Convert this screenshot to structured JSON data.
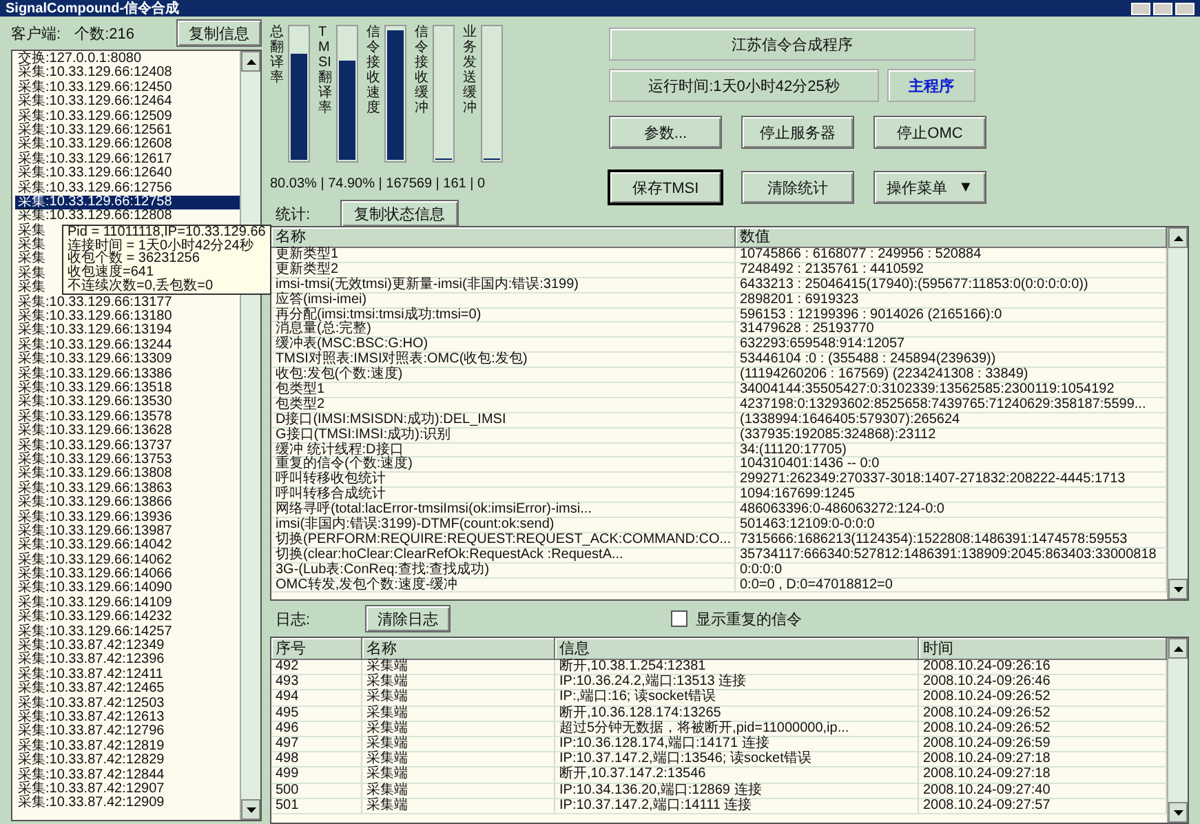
{
  "window": {
    "title": "SignalCompound-信令合成"
  },
  "clients": {
    "label": "客户端:",
    "count": "个数:216",
    "copy_button": "复制信息",
    "items": [
      {
        "text": "交换:127.0.0.1:8080",
        "selected": false
      },
      {
        "text": "采集:10.33.129.66:12408",
        "selected": false
      },
      {
        "text": "采集:10.33.129.66:12450",
        "selected": false
      },
      {
        "text": "采集:10.33.129.66:12464",
        "selected": false
      },
      {
        "text": "采集:10.33.129.66:12509",
        "selected": false
      },
      {
        "text": "采集:10.33.129.66:12561",
        "selected": false
      },
      {
        "text": "采集:10.33.129.66:12608",
        "selected": false
      },
      {
        "text": "采集:10.33.129.66:12617",
        "selected": false
      },
      {
        "text": "采集:10.33.129.66:12640",
        "selected": false
      },
      {
        "text": "采集:10.33.129.66:12756",
        "selected": false
      },
      {
        "text": "采集:10.33.129.66:12758",
        "selected": true
      },
      {
        "text": "采集:10.33.129.66:12808",
        "selected": false
      },
      {
        "text": "采集",
        "selected": false
      },
      {
        "text": "采集",
        "selected": false
      },
      {
        "text": "采集",
        "selected": false
      },
      {
        "text": "采集",
        "selected": false
      },
      {
        "text": "采集",
        "selected": false
      },
      {
        "text": "采集:10.33.129.66:13177",
        "selected": false
      },
      {
        "text": "采集:10.33.129.66:13180",
        "selected": false
      },
      {
        "text": "采集:10.33.129.66:13194",
        "selected": false
      },
      {
        "text": "采集:10.33.129.66:13244",
        "selected": false
      },
      {
        "text": "采集:10.33.129.66:13309",
        "selected": false
      },
      {
        "text": "采集:10.33.129.66:13386",
        "selected": false
      },
      {
        "text": "采集:10.33.129.66:13518",
        "selected": false
      },
      {
        "text": "采集:10.33.129.66:13530",
        "selected": false
      },
      {
        "text": "采集:10.33.129.66:13578",
        "selected": false
      },
      {
        "text": "采集:10.33.129.66:13628",
        "selected": false
      },
      {
        "text": "采集:10.33.129.66:13737",
        "selected": false
      },
      {
        "text": "采集:10.33.129.66:13753",
        "selected": false
      },
      {
        "text": "采集:10.33.129.66:13808",
        "selected": false
      },
      {
        "text": "采集:10.33.129.66:13863",
        "selected": false
      },
      {
        "text": "采集:10.33.129.66:13866",
        "selected": false
      },
      {
        "text": "采集:10.33.129.66:13936",
        "selected": false
      },
      {
        "text": "采集:10.33.129.66:13987",
        "selected": false
      },
      {
        "text": "采集:10.33.129.66:14042",
        "selected": false
      },
      {
        "text": "采集:10.33.129.66:14062",
        "selected": false
      },
      {
        "text": "采集:10.33.129.66:14066",
        "selected": false
      },
      {
        "text": "采集:10.33.129.66:14090",
        "selected": false
      },
      {
        "text": "采集:10.33.129.66:14109",
        "selected": false
      },
      {
        "text": "采集:10.33.129.66:14232",
        "selected": false
      },
      {
        "text": "采集:10.33.129.66:14257",
        "selected": false
      },
      {
        "text": "采集:10.33.87.42:12349",
        "selected": false
      },
      {
        "text": "采集:10.33.87.42:12396",
        "selected": false
      },
      {
        "text": "采集:10.33.87.42:12411",
        "selected": false
      },
      {
        "text": "采集:10.33.87.42:12465",
        "selected": false
      },
      {
        "text": "采集:10.33.87.42:12503",
        "selected": false
      },
      {
        "text": "采集:10.33.87.42:12613",
        "selected": false
      },
      {
        "text": "采集:10.33.87.42:12796",
        "selected": false
      },
      {
        "text": "采集:10.33.87.42:12819",
        "selected": false
      },
      {
        "text": "采集:10.33.87.42:12829",
        "selected": false
      },
      {
        "text": "采集:10.33.87.42:12844",
        "selected": false
      },
      {
        "text": "采集:10.33.87.42:12907",
        "selected": false
      },
      {
        "text": "采集:10.33.87.42:12909",
        "selected": false
      }
    ]
  },
  "tooltip": {
    "lines": [
      "Pid = 11011118,IP=10.33.129.66",
      "连接时间 = 1天0小时42分24秒",
      "收包个数 = 36231256",
      "收包速度=641",
      "不连续次数=0,丢包数=0"
    ]
  },
  "meters": [
    {
      "label": "总翻译率",
      "level": 0.8
    },
    {
      "label": "TMSI翻译率",
      "level": 0.75
    },
    {
      "label": "信令接收速度",
      "level": 0.98
    },
    {
      "label": "信令接收缓冲",
      "level": 0
    },
    {
      "label": "业务发送缓冲",
      "level": 0
    }
  ],
  "meter_summary": "80.03% | 74.90% | 167569 | 161 | 0",
  "stats_label": "统计:",
  "copy_status_button": "复制状态信息",
  "app_title": "江苏信令合成程序",
  "uptime": "运行时间:1天0小时42分25秒",
  "mode": "主程序",
  "buttons": [
    {
      "label": "参数...",
      "kind": "push",
      "default": false
    },
    {
      "label": "停止服务器",
      "kind": "push",
      "default": false
    },
    {
      "label": "停止OMC",
      "kind": "push",
      "default": false
    },
    {
      "label": "保存TMSI",
      "kind": "push",
      "default": true
    },
    {
      "label": "清除统计",
      "kind": "push",
      "default": false
    },
    {
      "label": "操作菜单",
      "kind": "menu",
      "caret": "▼",
      "default": false
    }
  ],
  "stats_table": {
    "columns": [
      "名称",
      "数值"
    ],
    "rows": [
      [
        "更新类型1",
        "10745866 : 6168077 : 249956 : 520884"
      ],
      [
        "更新类型2",
        "7248492 : 2135761 : 4410592"
      ],
      [
        "imsi-tmsi(无效tmsi)更新量-imsi(非国内:错误:3199)",
        "6433213 : 25046415(17940):(595677:11853:0(0:0:0:0:0))"
      ],
      [
        "应答(imsi-imei)",
        "2898201 : 6919323"
      ],
      [
        "再分配(imsi:tmsi:tmsi成功:tmsi=0)",
        "596153 : 12199396 : 9014026 (2165166):0"
      ],
      [
        "消息量(总:完整)",
        "31479628 : 25193770"
      ],
      [
        "缓冲表(MSC:BSC:G:HO)",
        "632293:659548:914:12057"
      ],
      [
        "TMSI对照表:IMSI对照表:OMC(收包:发包)",
        "53446104 :0 : (355488 : 245894(239639))"
      ],
      [
        "收包:发包(个数:速度)",
        "(11194260206 : 167569) (2234241308 : 33849)"
      ],
      [
        "包类型1",
        "34004144:35505427:0:3102339:13562585:2300119:1054192"
      ],
      [
        "包类型2",
        "4237198:0:13293602:8525658:7439765:71240629:358187:5599..."
      ],
      [
        "D接口(IMSI:MSISDN:成功):DEL_IMSI",
        "(1338994:1646405:579307):265624"
      ],
      [
        "G接口(TMSI:IMSI:成功):识别",
        "(337935:192085:324868):23112"
      ],
      [
        "缓冲 统计线程:D接口",
        "34:(11120:17705)"
      ],
      [
        "重复的信令(个数:速度)",
        "104310401:1436 -- 0:0"
      ],
      [
        "呼叫转移收包统计",
        "299271:262349:270337-3018:1407-271832:208222-4445:1713"
      ],
      [
        "呼叫转移合成统计",
        "1094:167699:1245"
      ],
      [
        "网络寻呼(total:lacError-tmsiImsi(ok:imsiError)-imsi...",
        "486063396:0-486063272:124-0:0"
      ],
      [
        "imsi(非国内:错误:3199)-DTMF(count:ok:send)",
        "501463:12109:0-0:0:0"
      ],
      [
        "切换(PERFORM:REQUIRE:REQUEST:REQUEST_ACK:COMMAND:CO...",
        "7315666:1686213(1124354):1522808:1486391:1474578:59553"
      ],
      [
        "切换(clear:hoClear:ClearRefOk:RequestAck :RequestA...",
        "35734117:666340:527812:1486391:138909:2045:863403:33000818"
      ],
      [
        "3G-(Lub表:ConReq:查找:查找成功)",
        "0:0:0:0"
      ],
      [
        "OMC转发,发包个数:速度-缓冲",
        "0:0=0 , D:0=47018812=0"
      ]
    ]
  },
  "log": {
    "label": "日志:",
    "clear_button": "清除日志",
    "show_duplicates": {
      "label": "显示重复的信令",
      "checked": false
    },
    "columns": [
      "序号",
      "名称",
      "信息",
      "时间"
    ],
    "rows": [
      [
        "492",
        "采集端",
        "断开,10.38.1.254:12381",
        "2008.10.24-09:26:16"
      ],
      [
        "493",
        "采集端",
        "IP:10.36.24.2,端口:13513 连接",
        "2008.10.24-09:26:46"
      ],
      [
        "494",
        "采集端",
        "IP:,端口:16; 读socket错误",
        "2008.10.24-09:26:52"
      ],
      [
        "495",
        "采集端",
        "断开,10.36.128.174:13265",
        "2008.10.24-09:26:52"
      ],
      [
        "496",
        "采集端",
        "超过5分钟无数据，将被断开,pid=11000000,ip...",
        "2008.10.24-09:26:52"
      ],
      [
        "497",
        "采集端",
        "IP:10.36.128.174,端口:14171 连接",
        "2008.10.24-09:26:59"
      ],
      [
        "498",
        "采集端",
        "IP:10.37.147.2,端口:13546; 读socket错误",
        "2008.10.24-09:27:18"
      ],
      [
        "499",
        "采集端",
        "断开,10.37.147.2:13546",
        "2008.10.24-09:27:18"
      ],
      [
        "500",
        "采集端",
        "IP:10.34.136.20,端口:12869 连接",
        "2008.10.24-09:27:40"
      ],
      [
        "501",
        "采集端",
        "IP:10.37.147.2,端口:14111 连接",
        "2008.10.24-09:27:57"
      ]
    ]
  }
}
